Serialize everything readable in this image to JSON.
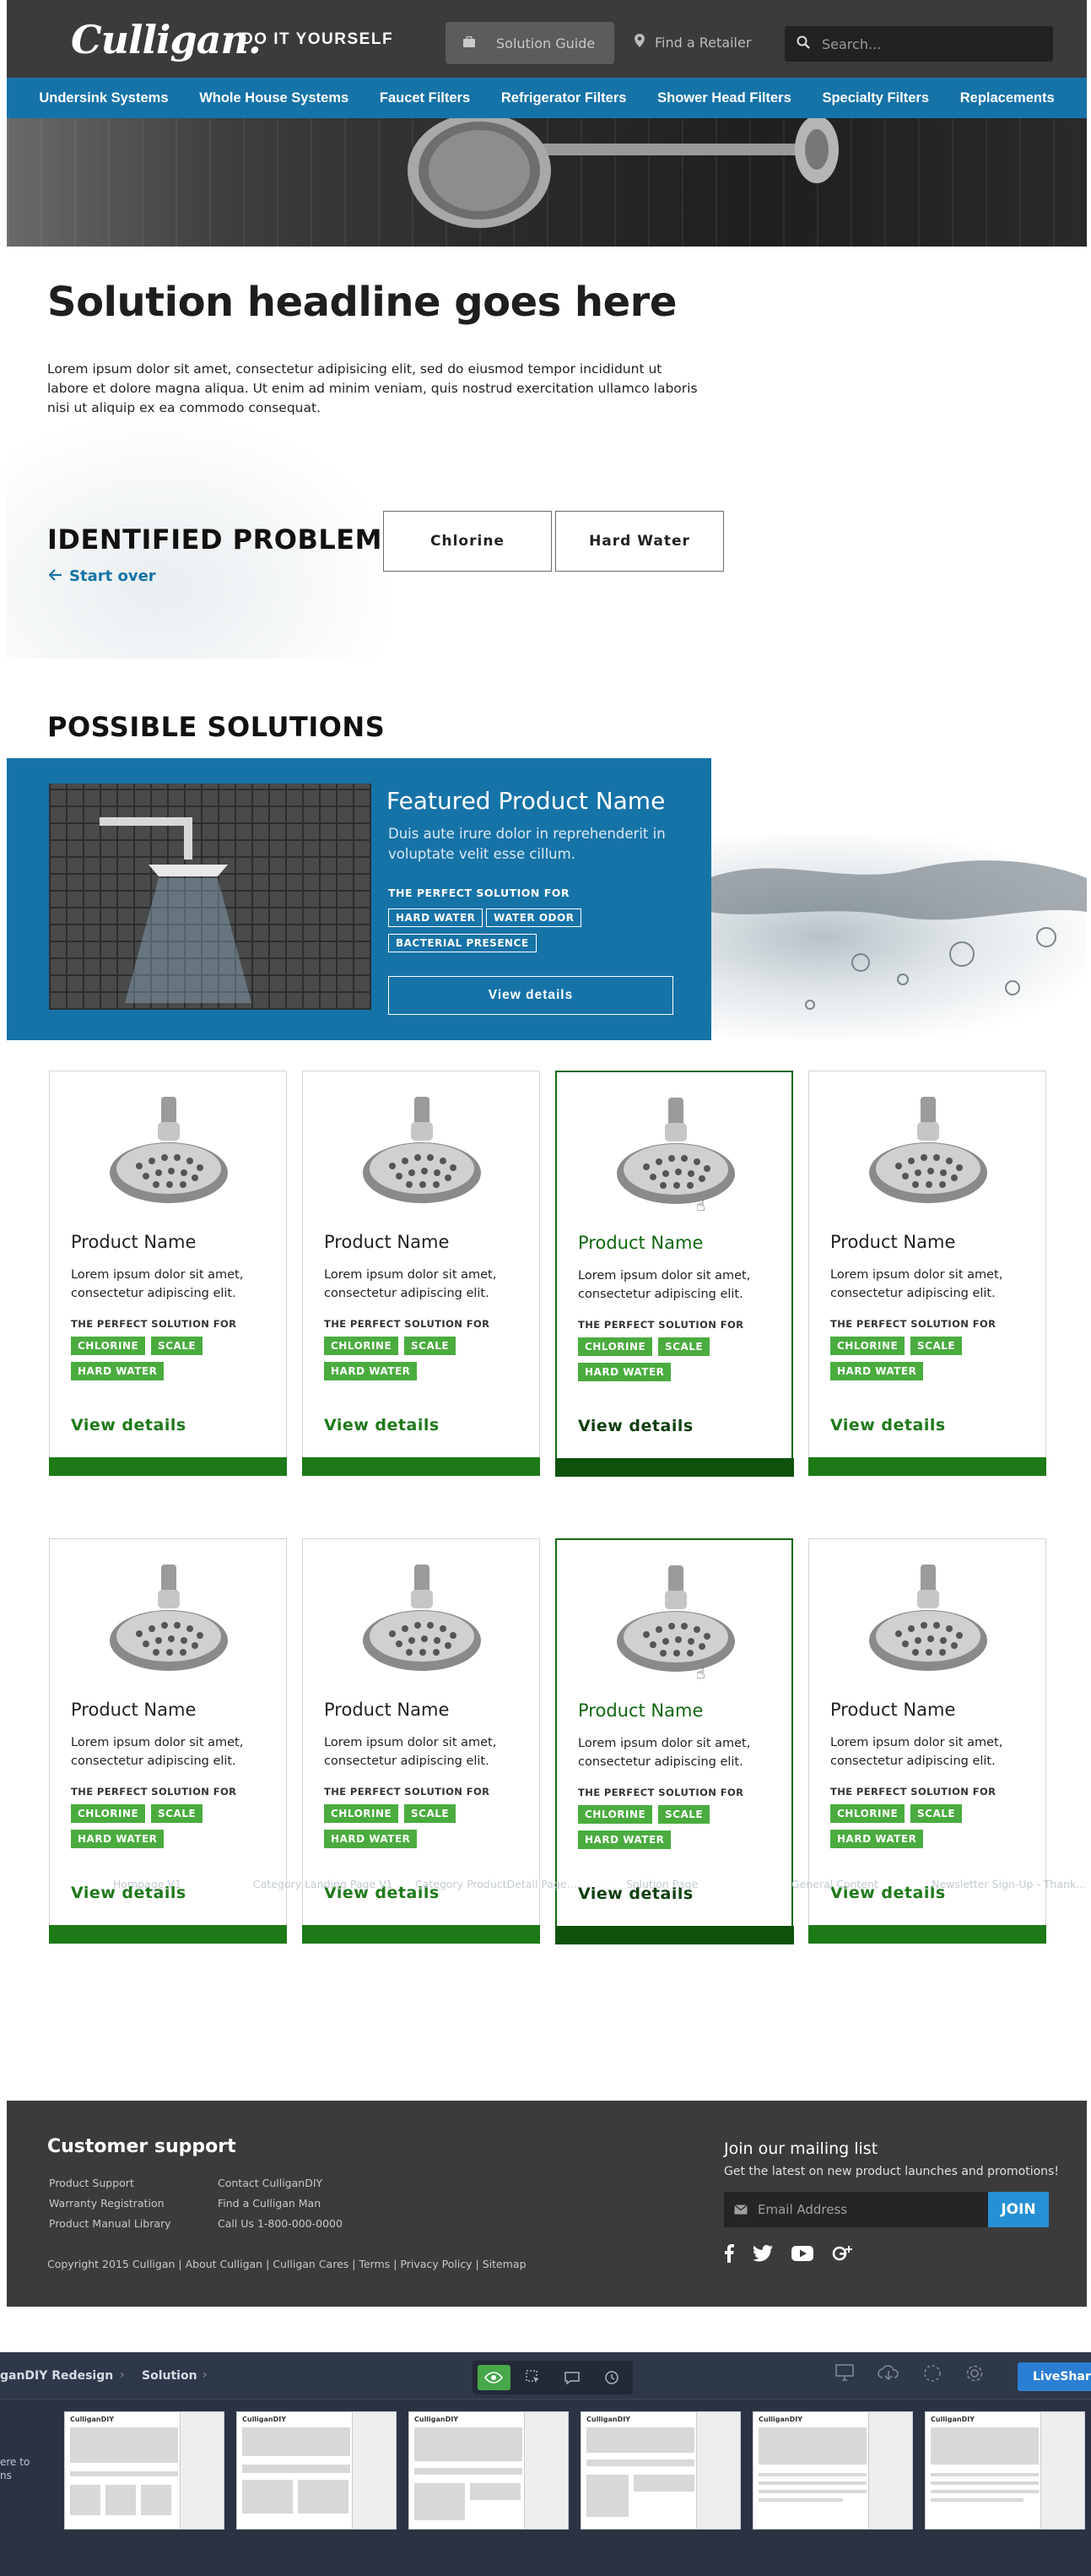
{
  "header": {
    "logo": "Culligan.",
    "tagline": "DO IT YOURSELF",
    "solution_guide": "Solution Guide",
    "find_retailer": "Find a Retailer",
    "search_placeholder": "Search..."
  },
  "nav": {
    "items": [
      "Undersink Systems",
      "Whole House Systems",
      "Faucet Filters",
      "Refrigerator Filters",
      "Shower Head Filters",
      "Specialty Filters",
      "Replacements"
    ]
  },
  "main": {
    "headline": "Solution headline goes here",
    "intro": "Lorem ipsum dolor sit amet, consectetur adipisicing elit, sed do eiusmod tempor incididunt ut labore et dolore magna aliqua. Ut enim ad minim veniam, quis nostrud exercitation ullamco laboris nisi ut aliquip ex ea commodo consequat.",
    "identified_problems": "IDENTIFIED PROBLEMS",
    "start_over": "Start over",
    "problems": [
      "Chlorine",
      "Hard Water"
    ],
    "possible_solutions": "POSSIBLE SOLUTIONS"
  },
  "featured": {
    "name": "Featured Product Name",
    "description": "Duis aute irure dolor in reprehenderit in voluptate velit esse cillum.",
    "perfect_for": "THE PERFECT SOLUTION FOR",
    "tags": [
      "HARD WATER",
      "WATER ODOR",
      "BACTERIAL PRESENCE"
    ],
    "button": "View details"
  },
  "products": {
    "name": "Product Name",
    "description": "Lorem ipsum dolor sit amet, consectetur adipiscing elit.",
    "perfect_for": "THE PERFECT SOLUTION FOR",
    "tags": [
      "CHLORINE",
      "SCALE",
      "HARD WATER"
    ],
    "view": "View details"
  },
  "footer": {
    "customer_support": "Customer support",
    "links_col1": [
      "Product Support",
      "Warranty Registration",
      "Product Manual Library"
    ],
    "links_col2": [
      "Contact CulliganDIY",
      "Find a Culligan Man",
      "Call Us 1-800-000-0000"
    ],
    "copyright": "Copyright 2015 Culligan  |  About Culligan  |  Culligan Cares  |  Terms  |  Privacy Policy  |  Sitemap",
    "mailing_title": "Join our mailing list",
    "mailing_sub": "Get the latest on new product launches and promotions!",
    "email_placeholder": "Email Address",
    "join": "JOIN"
  },
  "tool": {
    "project": "ganDIY Redesign",
    "page": "Solution",
    "liveshare": "LiveShare",
    "left_text_1": "ere to",
    "left_text_2": "ns",
    "thumbnails": [
      "Hompage V1",
      "Category Landing Page V1",
      "Category ProductDetail Page...",
      "Solution Page",
      "General Content",
      "Newsletter Sign-Up - Thank..."
    ]
  },
  "colors": {
    "header_bg": "#3b3b3b",
    "nav_blue": "#1673a8",
    "tag_green": "#4aac3f",
    "card_bar_green": "#1d7a17",
    "active_green": "#10670f",
    "join_blue": "#2591d4"
  }
}
